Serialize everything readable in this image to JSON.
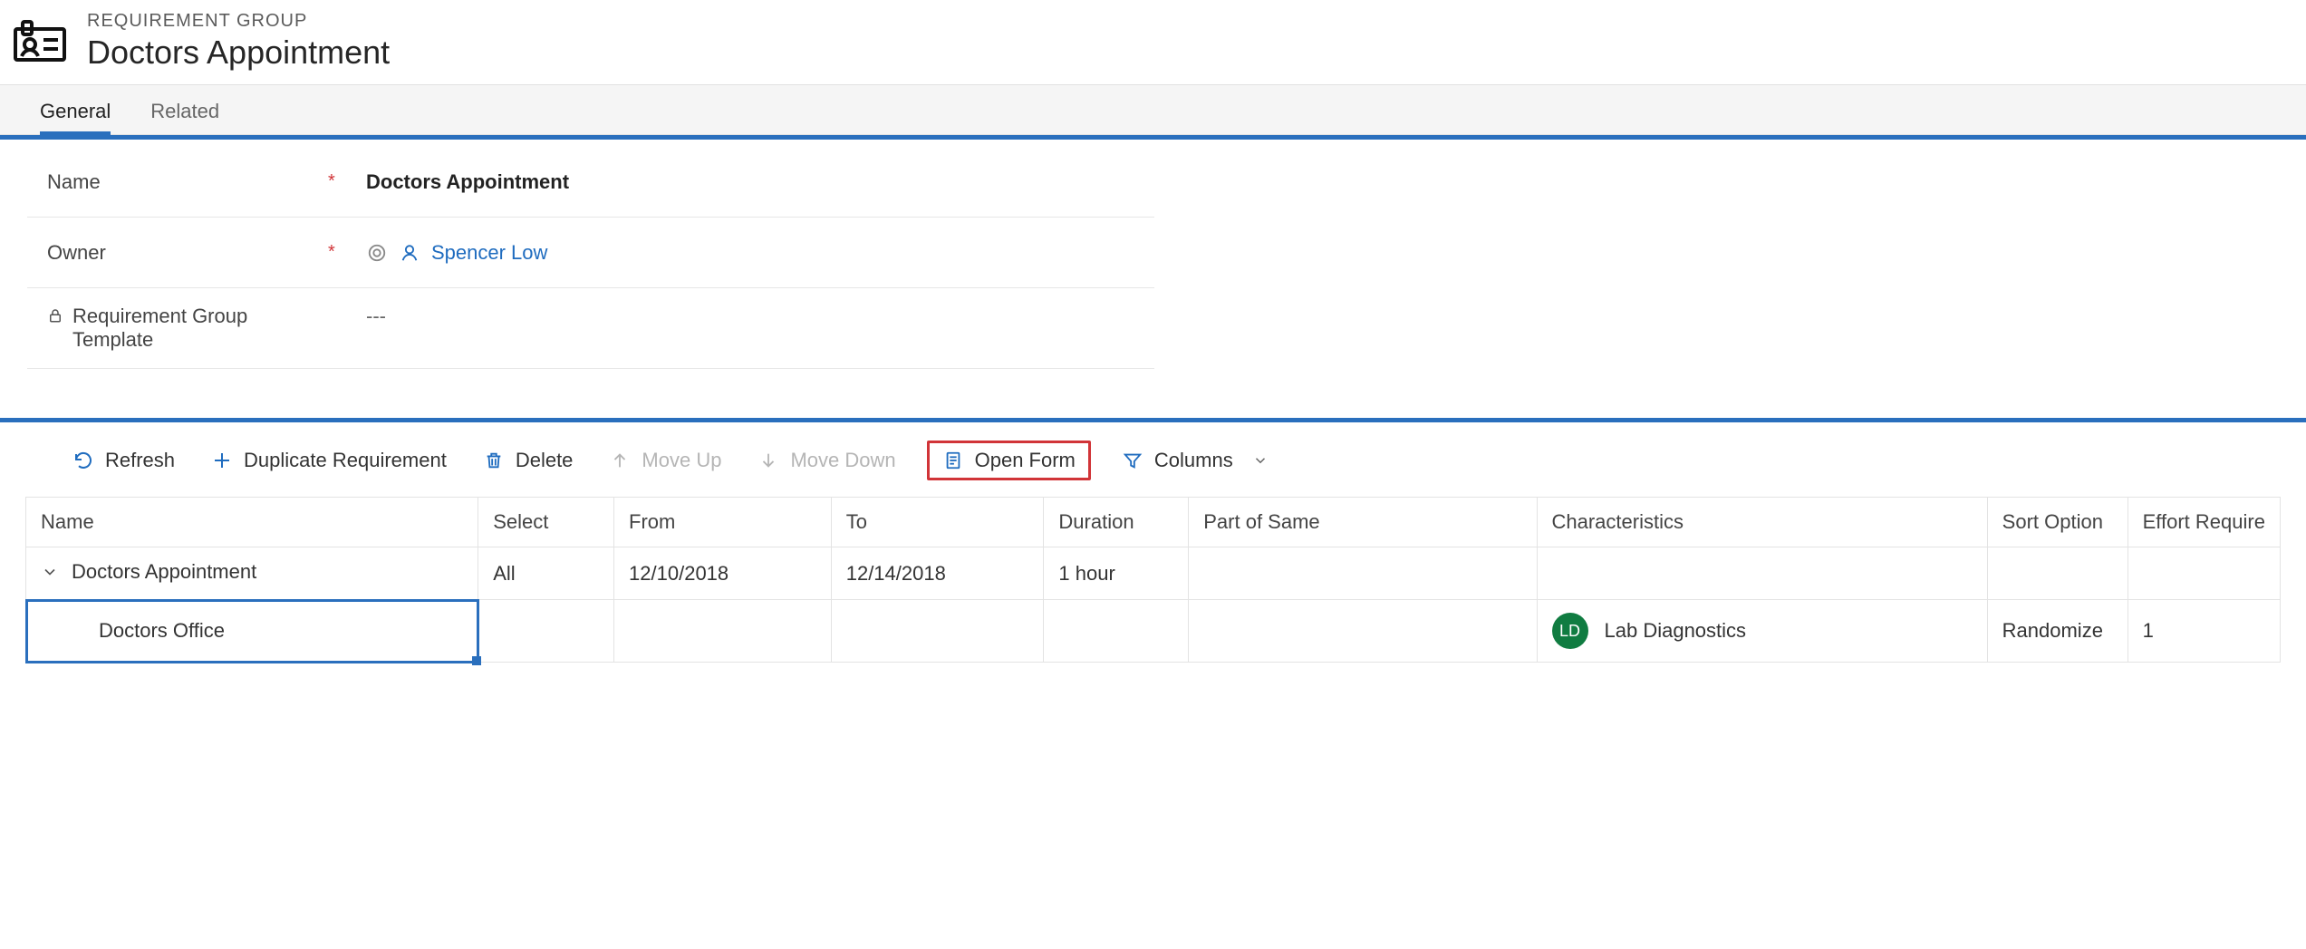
{
  "header": {
    "kicker": "REQUIREMENT GROUP",
    "title": "Doctors Appointment"
  },
  "tabs": {
    "general": "General",
    "related": "Related"
  },
  "form": {
    "name_label": "Name",
    "name_value": "Doctors Appointment",
    "owner_label": "Owner",
    "owner_value": "Spencer Low",
    "template_label": "Requirement Group Template",
    "template_value": "---"
  },
  "toolbar": {
    "refresh": "Refresh",
    "duplicate": "Duplicate Requirement",
    "delete": "Delete",
    "move_up": "Move Up",
    "move_down": "Move Down",
    "open_form": "Open Form",
    "columns": "Columns"
  },
  "grid": {
    "headers": {
      "name": "Name",
      "select": "Select",
      "from": "From",
      "to": "To",
      "duration": "Duration",
      "part_of_same": "Part of Same",
      "characteristics": "Characteristics",
      "sort_option": "Sort Option",
      "effort_required": "Effort Require"
    },
    "rows": [
      {
        "name": "Doctors Appointment",
        "select": "All",
        "from": "12/10/2018",
        "to": "12/14/2018",
        "duration": "1 hour",
        "part_of_same": "",
        "characteristics": "",
        "sort_option": "",
        "effort_required": ""
      },
      {
        "name": "Doctors Office",
        "select": "",
        "from": "",
        "to": "",
        "duration": "",
        "part_of_same": "",
        "characteristics": {
          "initials": "LD",
          "label": "Lab Diagnostics"
        },
        "sort_option": "Randomize",
        "effort_required": "1"
      }
    ]
  }
}
